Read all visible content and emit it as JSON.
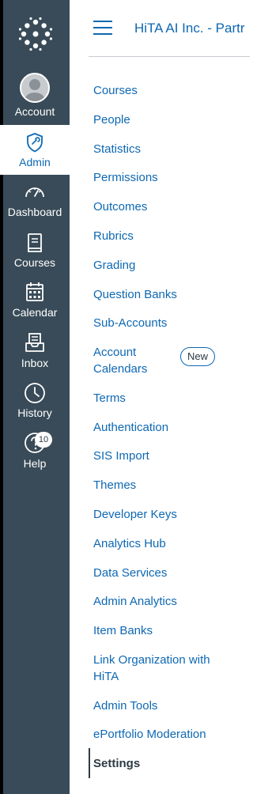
{
  "global_nav": {
    "logo_icon": "canvas-logo-icon",
    "items": [
      {
        "label": "Account",
        "icon": "avatar"
      },
      {
        "label": "Admin",
        "icon": "shield-icon",
        "active": true
      },
      {
        "label": "Dashboard",
        "icon": "dashboard-icon"
      },
      {
        "label": "Courses",
        "icon": "book-icon"
      },
      {
        "label": "Calendar",
        "icon": "calendar-icon"
      },
      {
        "label": "Inbox",
        "icon": "inbox-icon"
      },
      {
        "label": "History",
        "icon": "clock-icon"
      },
      {
        "label": "Help",
        "icon": "help-icon",
        "badge": "10"
      }
    ],
    "colors": {
      "background": "#394b58",
      "active_background": "#ffffff",
      "active_text": "#0e68b3"
    }
  },
  "header": {
    "menu_icon": "hamburger-icon",
    "title": "HiTA AI Inc. - Partr"
  },
  "account_nav": {
    "links": [
      "Courses",
      "People",
      "Statistics",
      "Permissions",
      "Outcomes",
      "Rubrics",
      "Grading",
      "Question Banks",
      "Sub-Accounts",
      "Account Calendars",
      "Terms",
      "Authentication",
      "SIS Import",
      "Themes",
      "Developer Keys",
      "Analytics Hub",
      "Data Services",
      "Admin Analytics",
      "Item Banks",
      "Link Organization with HiTA",
      "Admin Tools",
      "ePortfolio Moderation",
      "Settings"
    ],
    "new_badge": "New",
    "active": "Settings",
    "link_color": "#0e68b3",
    "active_color": "#2d3b45"
  }
}
